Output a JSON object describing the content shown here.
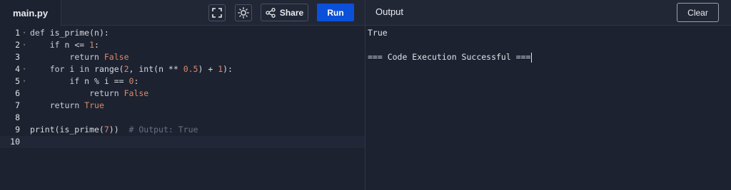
{
  "file_tab": {
    "label": "main.py"
  },
  "toolbar": {
    "fullscreen_icon": "fullscreen-icon",
    "theme_icon": "sun-icon",
    "share_label": "Share",
    "share_icon": "share-icon",
    "run_label": "Run"
  },
  "output_panel": {
    "title": "Output",
    "clear_label": "Clear",
    "lines": [
      "True",
      "",
      "=== Code Execution Successful ==="
    ]
  },
  "editor": {
    "lines": [
      {
        "num": "1",
        "fold": true,
        "tokens": [
          [
            "kw",
            "def"
          ],
          [
            "t",
            " is_prime(n):"
          ]
        ]
      },
      {
        "num": "2",
        "fold": true,
        "tokens": [
          [
            "t",
            "    "
          ],
          [
            "kw",
            "if"
          ],
          [
            "t",
            " n <= "
          ],
          [
            "num",
            "1"
          ],
          [
            "t",
            ":"
          ]
        ]
      },
      {
        "num": "3",
        "fold": false,
        "tokens": [
          [
            "t",
            "        "
          ],
          [
            "kw",
            "return"
          ],
          [
            "t",
            " "
          ],
          [
            "bool",
            "False"
          ]
        ]
      },
      {
        "num": "4",
        "fold": true,
        "tokens": [
          [
            "t",
            "    "
          ],
          [
            "kw",
            "for"
          ],
          [
            "t",
            " i "
          ],
          [
            "kw",
            "in"
          ],
          [
            "t",
            " range("
          ],
          [
            "num",
            "2"
          ],
          [
            "t",
            ", int(n ** "
          ],
          [
            "num",
            "0.5"
          ],
          [
            "t",
            ") + "
          ],
          [
            "num",
            "1"
          ],
          [
            "t",
            "):"
          ]
        ]
      },
      {
        "num": "5",
        "fold": true,
        "tokens": [
          [
            "t",
            "        "
          ],
          [
            "kw",
            "if"
          ],
          [
            "t",
            " n % i == "
          ],
          [
            "num",
            "0"
          ],
          [
            "t",
            ":"
          ]
        ]
      },
      {
        "num": "6",
        "fold": false,
        "tokens": [
          [
            "t",
            "            "
          ],
          [
            "kw",
            "return"
          ],
          [
            "t",
            " "
          ],
          [
            "bool",
            "False"
          ]
        ]
      },
      {
        "num": "7",
        "fold": false,
        "tokens": [
          [
            "t",
            "    "
          ],
          [
            "kw",
            "return"
          ],
          [
            "t",
            " "
          ],
          [
            "bool",
            "True"
          ]
        ]
      },
      {
        "num": "8",
        "fold": false,
        "tokens": []
      },
      {
        "num": "9",
        "fold": false,
        "tokens": [
          [
            "t",
            "print(is_prime("
          ],
          [
            "num",
            "7"
          ],
          [
            "t",
            "))  "
          ],
          [
            "cmt",
            "# Output: True"
          ]
        ]
      },
      {
        "num": "10",
        "fold": false,
        "tokens": []
      }
    ],
    "active_line": "10"
  }
}
